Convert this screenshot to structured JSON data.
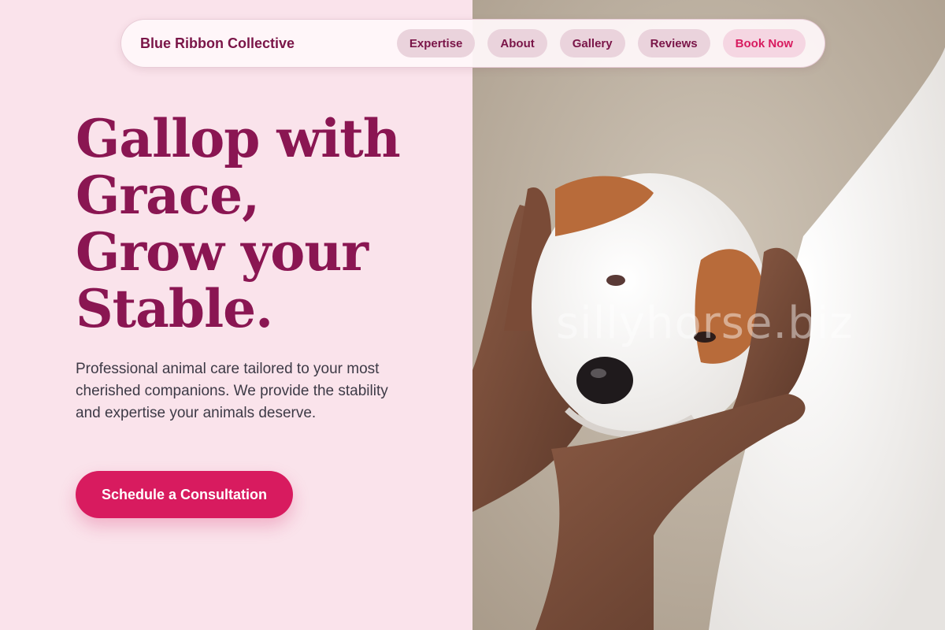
{
  "brand": "Blue Ribbon Collective",
  "nav": {
    "items": [
      {
        "label": "Expertise"
      },
      {
        "label": "About"
      },
      {
        "label": "Gallery"
      },
      {
        "label": "Reviews"
      },
      {
        "label": "Book Now"
      }
    ]
  },
  "hero": {
    "title_lines": [
      "Gallop with",
      "Grace,",
      "Grow your",
      "Stable."
    ],
    "description": "Professional animal care tailored to your most cherished companions. We provide the stability and expertise your animals deserve.",
    "cta_label": "Schedule a Consultation"
  },
  "image": {
    "watermark": "sillyhorse.biz",
    "subject": "hands-holding-puppy-photo"
  },
  "colors": {
    "accent": "#d81b5f",
    "brand_text": "#7a1548",
    "title": "#8a1652",
    "background": "#fae3eb"
  }
}
